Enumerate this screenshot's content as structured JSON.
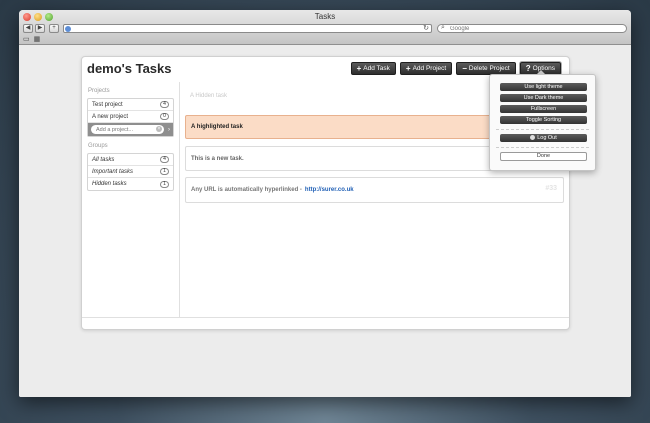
{
  "browser": {
    "title": "Tasks",
    "search_placeholder": "Google"
  },
  "app": {
    "title": "demo's Tasks",
    "toolbar": {
      "add_task": "Add Task",
      "add_project": "Add Project",
      "delete_project": "Delete Project",
      "options": "Options"
    }
  },
  "sidebar": {
    "projects_header": "Projects",
    "projects": [
      {
        "label": "Test project",
        "count": "4"
      },
      {
        "label": "A new project",
        "count": "0"
      }
    ],
    "add_project_placeholder": "Add a project...",
    "groups_header": "Groups",
    "groups": [
      {
        "label": "All tasks",
        "count": "4"
      },
      {
        "label": "Important tasks",
        "count": "1"
      },
      {
        "label": "Hidden tasks",
        "count": "1"
      }
    ]
  },
  "tasks": [
    {
      "text": "A Hidden task",
      "id": ""
    },
    {
      "text": "A highlighted task",
      "id": ""
    },
    {
      "text": "This is a new task.",
      "id": ""
    },
    {
      "text": "Any URL is automatically hyperlinked -",
      "link": "http://surer.co.uk",
      "id": "#33"
    }
  ],
  "options_menu": {
    "items": [
      "Use light theme",
      "Use Dark theme",
      "Fullscreen",
      "Toggle Sorting"
    ],
    "log_out": "Log Out",
    "done": "Done"
  },
  "colors": {
    "highlight_bg": "#fbdcc6",
    "link": "#1f5fb5",
    "button_dark": "#333333"
  }
}
